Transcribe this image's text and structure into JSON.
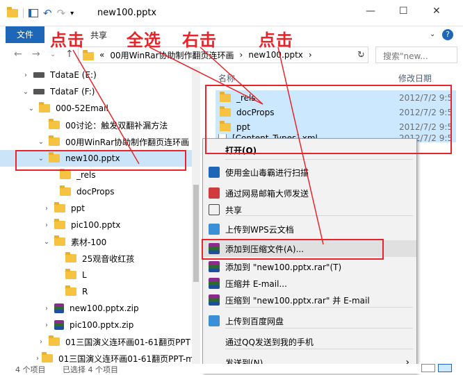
{
  "window": {
    "title": "new100.pptx",
    "minimize": "—",
    "maximize": "☐",
    "close": "✕"
  },
  "ribbon": {
    "file_tab": "文件",
    "share_tab": "共享",
    "help": "?"
  },
  "address": {
    "crumbs": [
      "«",
      "00用WinRar协助制作翻页连环画",
      "›",
      "new100.pptx",
      "›"
    ],
    "search_placeholder": "搜索\"new..."
  },
  "tree": [
    {
      "label": "TdataE (E:)",
      "type": "drive",
      "expander": "›"
    },
    {
      "label": "TdataF (F:)",
      "type": "drive",
      "expander": "⌄"
    },
    {
      "label": "000-52Email",
      "type": "folder",
      "expander": "⌄"
    },
    {
      "label": "00讨论：触发双翻补漏方法",
      "type": "folder",
      "expander": ""
    },
    {
      "label": "00用WinRar协助制作翻页连环画",
      "type": "folder",
      "expander": "⌄"
    },
    {
      "label": "new100.pptx",
      "type": "folder",
      "expander": "⌄"
    },
    {
      "label": "_rels",
      "type": "folder",
      "expander": ""
    },
    {
      "label": "docProps",
      "type": "folder",
      "expander": ""
    },
    {
      "label": "ppt",
      "type": "folder",
      "expander": "›"
    },
    {
      "label": "pic100.pptx",
      "type": "folder",
      "expander": "›"
    },
    {
      "label": "素材-100",
      "type": "folder",
      "expander": "⌄"
    },
    {
      "label": "25观音收红孩",
      "type": "folder",
      "expander": ""
    },
    {
      "label": "L",
      "type": "folder",
      "expander": ""
    },
    {
      "label": "R",
      "type": "folder",
      "expander": ""
    },
    {
      "label": "new100.pptx.zip",
      "type": "zip",
      "expander": "›"
    },
    {
      "label": "pic100.pptx.zip",
      "type": "zip",
      "expander": "›"
    },
    {
      "label": "01三国演义连环画01-61翻页PPT",
      "type": "folder",
      "expander": "›"
    },
    {
      "label": "01三国演义连环画01-61翻页PPT-m",
      "type": "folder",
      "expander": "›"
    }
  ],
  "list": {
    "col_name": "名称",
    "col_date": "修改日期",
    "rows": [
      {
        "name": "_rels",
        "date": "2012/7/2 9:5"
      },
      {
        "name": "docProps",
        "date": "2012/7/2 9:5"
      },
      {
        "name": "ppt",
        "date": "2012/7/2 9:5"
      },
      {
        "name": "[Content_Types].xml",
        "date": "2012/7/2 9:5"
      }
    ]
  },
  "context_menu": [
    {
      "label": "打开(O)",
      "icon": "none",
      "bold": true
    },
    {
      "label": "使用金山毒霸进行扫描",
      "icon": "shield-icon",
      "color": "#1e67b8"
    },
    {
      "label": "通过网易邮箱大师发送",
      "icon": "mail-icon",
      "color": "#d23b3b"
    },
    {
      "label": "共享",
      "icon": "share-icon",
      "color": "#444444"
    },
    {
      "label": "上传到WPS云文档",
      "icon": "cloud-icon",
      "color": "#3b8fd6"
    },
    {
      "label": "添加到压缩文件(A)...",
      "icon": "winrar-icon",
      "color": "#8a2d8a"
    },
    {
      "label": "添加到 \"new100.pptx.rar\"(T)",
      "icon": "winrar-icon",
      "color": "#8a2d8a"
    },
    {
      "label": "压缩并 E-mail...",
      "icon": "winrar-icon",
      "color": "#8a2d8a"
    },
    {
      "label": "压缩到 \"new100.pptx.rar\" 并 E-mail",
      "icon": "winrar-icon",
      "color": "#8a2d8a"
    },
    {
      "label": "上传到百度网盘",
      "icon": "baidu-icon",
      "color": "#3b8fd6"
    },
    {
      "label": "通过QQ发送到我的手机",
      "icon": "none"
    },
    {
      "label": "发送到(N)",
      "icon": "none",
      "submenu": "›"
    }
  ],
  "status": {
    "count": "4 个项目",
    "selected": "已选择 4 个项目"
  },
  "annotations": {
    "click1": "点击",
    "select_all": "全选",
    "right_click": "右击",
    "click2": "点击"
  },
  "colors": {
    "accent": "#1e67b8",
    "annotation_red": "#e8242a",
    "selection": "#cce8ff"
  }
}
